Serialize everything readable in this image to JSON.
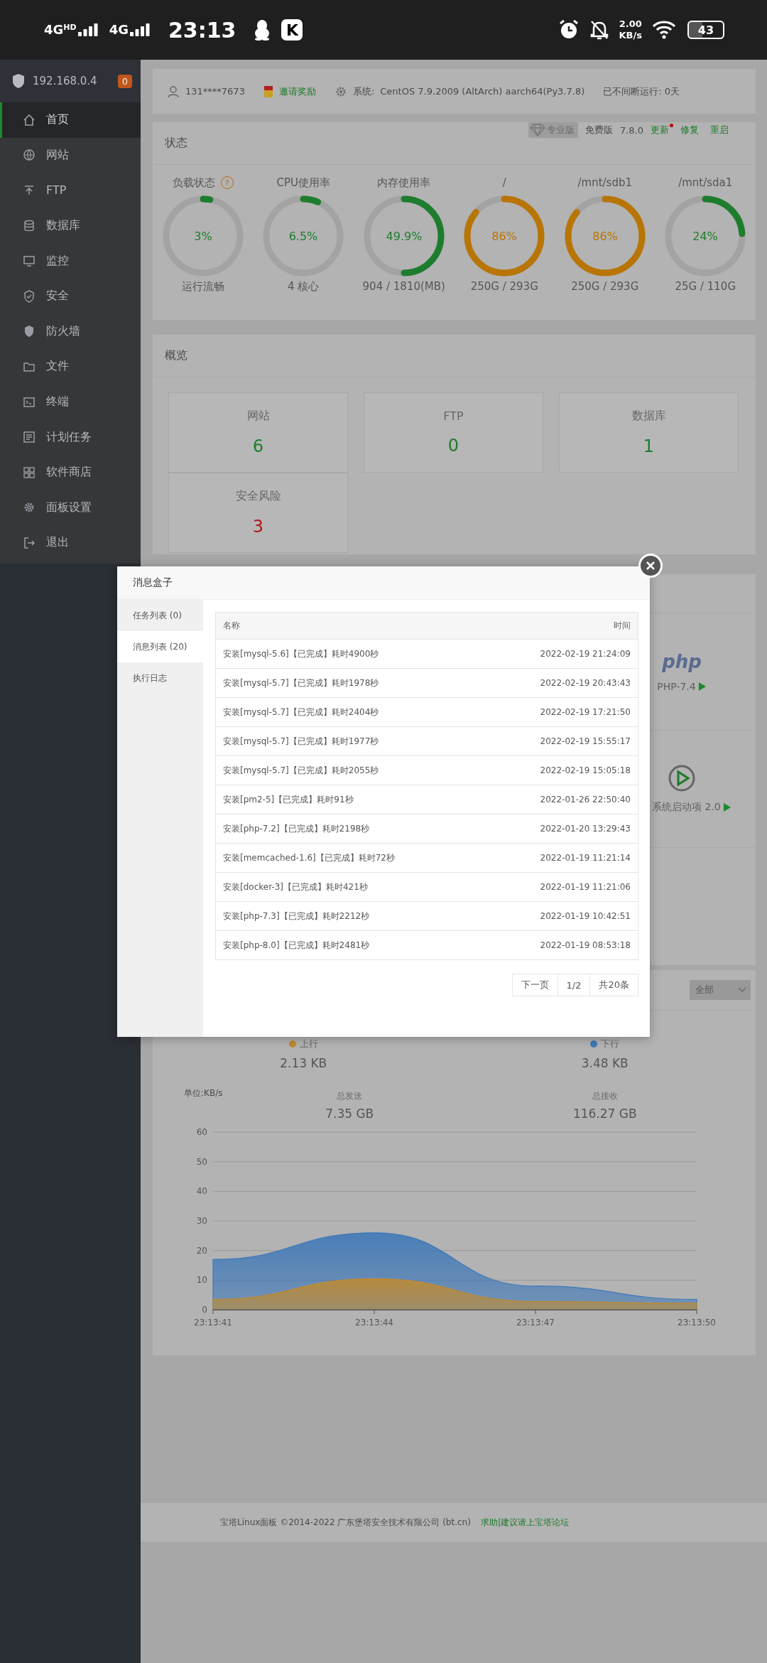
{
  "status_bar": {
    "signals": [
      {
        "label": "4G",
        "badge": "HD"
      },
      {
        "label": "4G"
      }
    ],
    "time": "23:13",
    "app_badge": "K",
    "speed": "2.00",
    "speed_unit": "KB/s",
    "battery": "43"
  },
  "sidebar": {
    "host": "192.168.0.4",
    "badge": "0",
    "items": [
      {
        "label": "首页",
        "selected": true
      },
      {
        "label": "网站",
        "selected": false
      },
      {
        "label": "FTP",
        "selected": false
      },
      {
        "label": "数据库",
        "selected": false
      },
      {
        "label": "监控",
        "selected": false
      },
      {
        "label": "安全",
        "selected": false
      },
      {
        "label": "防火墙",
        "selected": false
      },
      {
        "label": "文件",
        "selected": false
      },
      {
        "label": "终端",
        "selected": false
      },
      {
        "label": "计划任务",
        "selected": false
      },
      {
        "label": "软件商店",
        "selected": false
      },
      {
        "label": "面板设置",
        "selected": false
      },
      {
        "label": "退出",
        "selected": false
      }
    ]
  },
  "header_bar": {
    "user": "131****7673",
    "invite": "邀请奖励",
    "system_label": "系统:",
    "system": "CentOS 7.9.2009 (AltArch) aarch64(Py3.7.8)",
    "uptime": "已不间断运行: 0天"
  },
  "status": {
    "title": "状态",
    "pro": "专业版",
    "edition": "免费版",
    "version": "7.8.0",
    "actions": [
      {
        "label": "更新",
        "notify": true
      },
      {
        "label": "修复",
        "notify": false
      },
      {
        "label": "重启",
        "notify": false
      }
    ],
    "gauges": [
      {
        "title": "负载状态",
        "help": "?",
        "value": "3%",
        "level": 0.03,
        "color": "#1e7d2d",
        "caption": "运行流畅"
      },
      {
        "title": "CPU使用率",
        "value": "6.5%",
        "level": 0.065,
        "color": "#1e7d2d",
        "caption": "4 核心"
      },
      {
        "title": "内存使用率",
        "value": "49.9%",
        "level": 0.499,
        "color": "#1e7d2d",
        "caption": "904 / 1810(MB)"
      },
      {
        "title": "/",
        "value": "86%",
        "level": 0.86,
        "color": "#b87503",
        "caption": "250G / 293G"
      },
      {
        "title": "/mnt/sdb1",
        "value": "86%",
        "level": 0.86,
        "color": "#b87503",
        "caption": "250G / 293G"
      },
      {
        "title": "/mnt/sda1",
        "value": "24%",
        "level": 0.24,
        "color": "#1e7d2d",
        "caption": "25G / 110G"
      }
    ]
  },
  "overview": {
    "title": "概览",
    "tiles": [
      {
        "label": "网站",
        "value": "6",
        "color": "#1e7d2d"
      },
      {
        "label": "FTP",
        "value": "0",
        "color": "#1e7d2d"
      },
      {
        "label": "数据库",
        "value": "1",
        "color": "#1e7d2d"
      },
      {
        "label": "安全风险",
        "value": "3",
        "color": "#b01818"
      }
    ]
  },
  "software": {
    "tiles": [
      {
        "kind": "logo",
        "logo": "php",
        "label": "PHP-7.4"
      },
      {
        "kind": "icon",
        "label": "系统启动项 2.0"
      }
    ]
  },
  "network": {
    "filter": "全部",
    "stats": [
      {
        "value": "2.13 KB",
        "total_label": "总发送",
        "total": "7.35 GB"
      },
      {
        "value": "3.48 KB",
        "total_label": "总接收",
        "total": "116.27 GB"
      }
    ],
    "chart_data": {
      "type": "area",
      "ylabel": "单位:KB/s",
      "categories": [
        "23:13:41",
        "23:13:44",
        "23:13:47",
        "23:13:50"
      ],
      "series": [
        {
          "name": "上行",
          "color": "#c08a30",
          "values": [
            3.5,
            10.5,
            2.8,
            2.2
          ]
        },
        {
          "name": "下行",
          "color": "#3f78b8",
          "values": [
            17,
            26,
            8,
            3.5
          ]
        }
      ],
      "ylim": [
        0,
        60
      ],
      "grid": true,
      "yticks": [
        0,
        10,
        20,
        30,
        40,
        50,
        60
      ]
    }
  },
  "footer": {
    "copyright": "宝塔Linux面板 ©2014-2022 广东堡塔安全技术有限公司 (bt.cn)",
    "link": "求助|建议请上宝塔论坛"
  },
  "modal": {
    "title": "消息盒子",
    "tabs": [
      {
        "label": "任务列表 (0)",
        "selected": false
      },
      {
        "label": "消息列表 (20)",
        "selected": true
      },
      {
        "label": "执行日志",
        "selected": false
      }
    ],
    "columns": [
      "名称",
      "时间"
    ],
    "rows": [
      {
        "name": "安装[mysql-5.6]【已完成】耗时4900秒",
        "time": "2022-02-19 21:24:09"
      },
      {
        "name": "安装[mysql-5.7]【已完成】耗时1978秒",
        "time": "2022-02-19 20:43:43"
      },
      {
        "name": "安装[mysql-5.7]【已完成】耗时2404秒",
        "time": "2022-02-19 17:21:50"
      },
      {
        "name": "安装[mysql-5.7]【已完成】耗时1977秒",
        "time": "2022-02-19 15:55:17"
      },
      {
        "name": "安装[mysql-5.7]【已完成】耗时2055秒",
        "time": "2022-02-19 15:05:18"
      },
      {
        "name": "安装[pm2-5]【已完成】耗时91秒",
        "time": "2022-01-26 22:50:40"
      },
      {
        "name": "安装[php-7.2]【已完成】耗时2198秒",
        "time": "2022-01-20 13:29:43"
      },
      {
        "name": "安装[memcached-1.6]【已完成】耗时72秒",
        "time": "2022-01-19 11:21:14"
      },
      {
        "name": "安装[docker-3]【已完成】耗时421秒",
        "time": "2022-01-19 11:21:06"
      },
      {
        "name": "安装[php-7.3]【已完成】耗时2212秒",
        "time": "2022-01-19 10:42:51"
      },
      {
        "name": "安装[php-8.0]【已完成】耗时2481秒",
        "time": "2022-01-19 08:53:18"
      }
    ],
    "pagination": [
      "下一页",
      "1/2",
      "共20条"
    ]
  }
}
